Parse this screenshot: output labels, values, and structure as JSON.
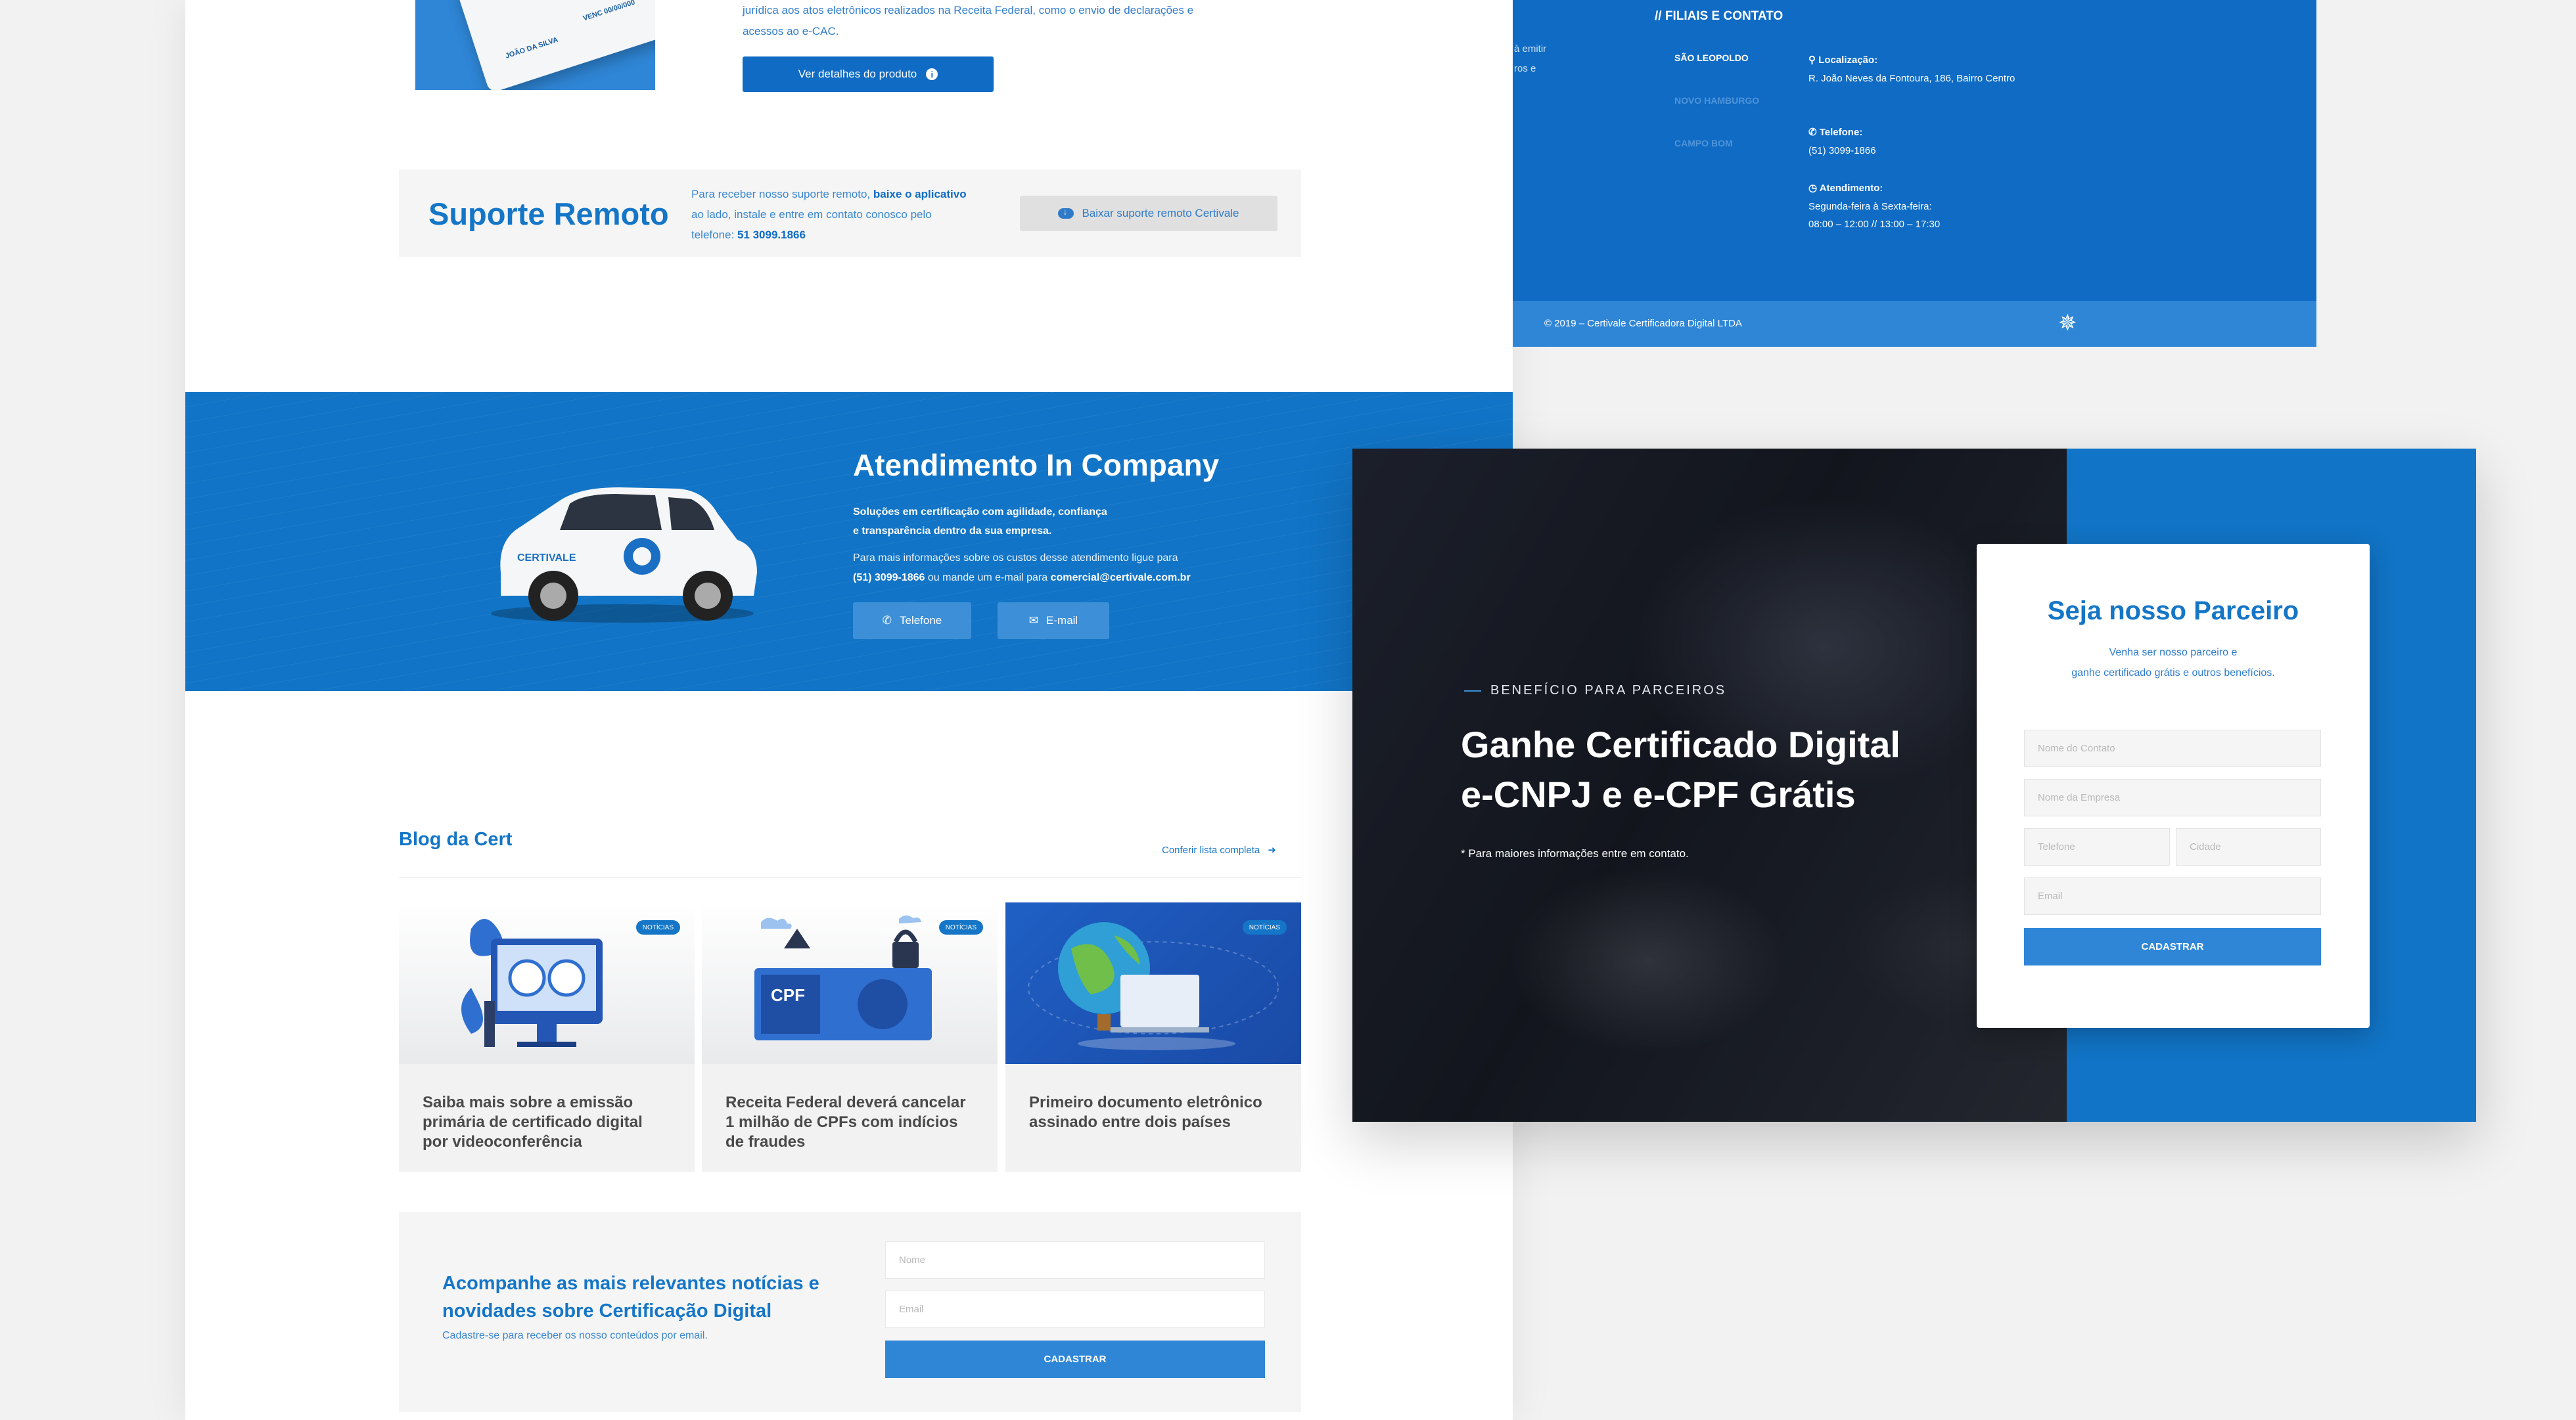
{
  "product": {
    "card_name": "JOÃO DA SILVA",
    "card_expiry": "VENC 00/00/000",
    "description": "jurídica aos atos eletrônicos realizados na Receita Federal, como o envio de declarações e acessos ao e-CAC.",
    "button_label": "Ver detalhes do produto",
    "button_icon": "info-icon"
  },
  "support": {
    "title": "Suporte Remoto",
    "text_1": "Para receber nosso suporte remoto, ",
    "text_bold_1": "baixe o aplicativo",
    "text_2": " ao lado, instale e entre em contato conosco pelo telefone: ",
    "phone": "51 3099.1866",
    "button_label": "Baixar suporte remoto Certivale",
    "button_icon": "cloud-download-icon"
  },
  "company": {
    "title": "Atendimento In Company",
    "subtitle_1": "Soluções em certificação com agilidade, confiança",
    "subtitle_2": "e transparência dentro da sua empresa.",
    "info_1": "Para mais informações sobre os custos desse atendimento ligue para",
    "info_phone": "(51) 3099-1866",
    "info_2": " ou mande um e-mail para ",
    "info_email": "comercial@certivale.com.br",
    "btn_phone": "Telefone",
    "btn_email": "E-mail",
    "car_label": "CERTIVALE"
  },
  "blog": {
    "title": "Blog da Cert",
    "link": "Conferir lista completa",
    "posts": [
      {
        "badge": "NOTÍCIAS",
        "title": "Saiba mais sobre a emissão primária de certificado digital por videoconferência"
      },
      {
        "badge": "NOTÍCIAS",
        "title": "Receita Federal deverá cancelar 1 milhão de CPFs com indícios de fraudes"
      },
      {
        "badge": "NOTÍCIAS",
        "title": "Primeiro documento eletrônico assinado entre dois países"
      }
    ],
    "cpf_label": "CPF"
  },
  "newsletter": {
    "title": "Acompanhe as mais relevantes notícias e novidades sobre Certificação Digital",
    "subtitle": "Cadastre-se para receber os nosso conteúdos por email.",
    "name_placeholder": "Nome",
    "email_placeholder": "Email",
    "button_label": "CADASTRAR"
  },
  "footer": {
    "heading": "// FILIAIS E CONTATO",
    "fragment_1": "à emitir",
    "fragment_2": "ros e",
    "branches": [
      "SÃO LEOPOLDO",
      "NOVO HAMBURGO",
      "CAMPO BOM"
    ],
    "location_label": "Localização:",
    "location_value": "R. João Neves da Fontoura, 186, Bairro Centro",
    "phone_label": "Telefone:",
    "phone_value": "(51) 3099-1866",
    "hours_label": "Atendimento:",
    "hours_days": "Segunda-feira à Sexta-feira:",
    "hours_value": "08:00 – 12:00 // 13:00 – 17:30",
    "copyright": "© 2019 – Certivale Certificadora Digital LTDA"
  },
  "partner": {
    "kicker": "BENEFÍCIO PARA PARCEIROS",
    "title_1": "Ganhe Certificado Digital",
    "title_2": "e-CNPJ e e-CPF Grátis",
    "note": "* Para maiores informações entre em contato.",
    "form_title": "Seja nosso Parceiro",
    "form_sub_1": "Venha ser nosso parceiro e",
    "form_sub_2": "ganhe certificado grátis e outros benefícios.",
    "ph_contact": "Nome do Contato",
    "ph_company": "Nome da Empresa",
    "ph_phone": "Telefone",
    "ph_city": "Cidade",
    "ph_email": "Email",
    "button_label": "CADASTRAR"
  },
  "colors": {
    "brand_blue": "#0f6bc4",
    "light_blue": "#2f86d6",
    "text_blue": "#1576c7"
  }
}
